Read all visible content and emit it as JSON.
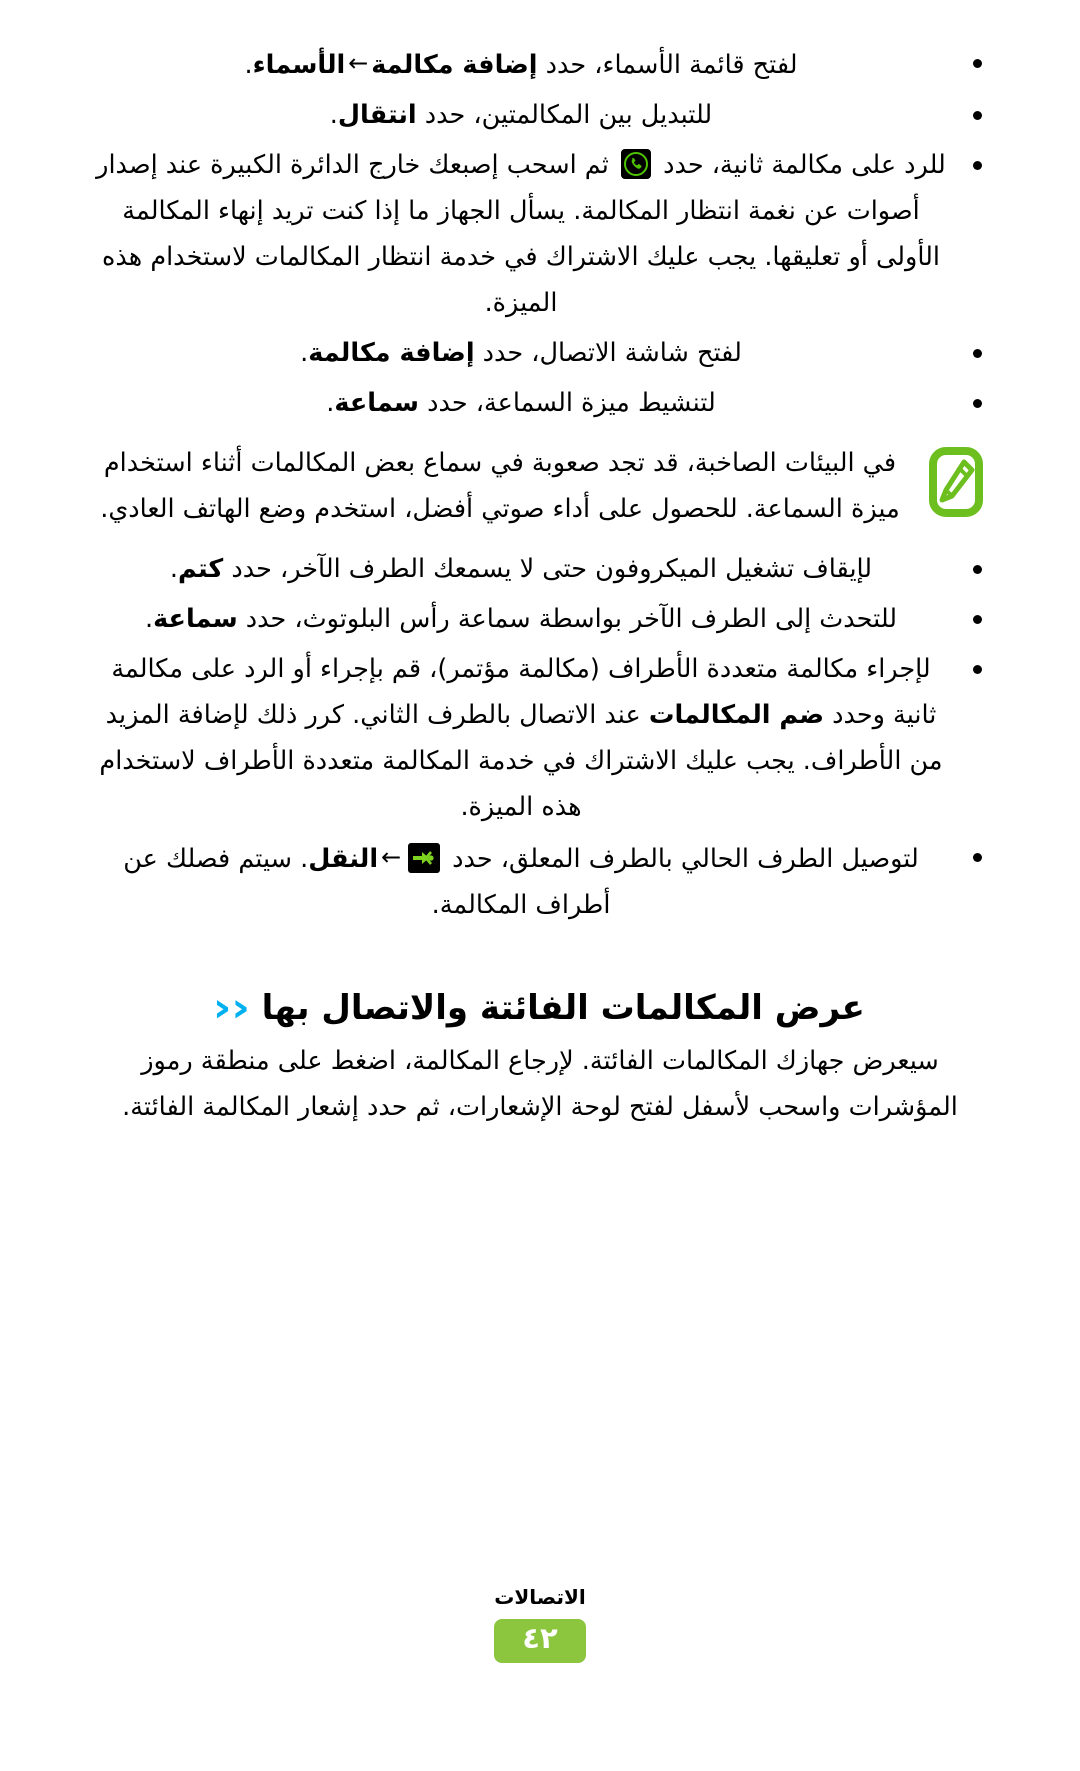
{
  "page": {
    "language": "ar",
    "direction": "rtl"
  },
  "colors": {
    "heading_chevron": "#00b0f0",
    "note_icon_green": "#6cbf1f",
    "icon_green": "#4fc400",
    "page_badge_green": "#8cc63f",
    "text": "#000000",
    "background": "#ffffff"
  },
  "bullets": [
    {
      "id": "open-contacts-list",
      "parts": [
        {
          "type": "text",
          "value": "لفتح قائمة الأسماء، حدد "
        },
        {
          "type": "bold",
          "value": "إضافة مكالمة"
        },
        {
          "type": "arrow",
          "value": "←"
        },
        {
          "type": "bold",
          "value": "الأسماء"
        },
        {
          "type": "text",
          "value": "."
        }
      ],
      "plain": "لفتح قائمة الأسماء، حدد إضافة مكالمة ← الأسماء."
    },
    {
      "id": "switch-between-calls",
      "parts": [
        {
          "type": "text",
          "value": "للتبديل بين المكالمتين، حدد "
        },
        {
          "type": "bold",
          "value": "انتقال"
        },
        {
          "type": "text",
          "value": "."
        }
      ],
      "plain": "للتبديل بين المكالمتين، حدد انتقال."
    },
    {
      "id": "answer-second-call",
      "parts": [
        {
          "type": "text",
          "value": "للرد على مكالمة ثانية، حدد "
        },
        {
          "type": "icon",
          "value": "call-answer-icon"
        },
        {
          "type": "text",
          "value": " ثم اسحب إصبعك خارج الدائرة الكبيرة عند إصدار أصوات عن نغمة انتظار المكالمة. يسأل الجهاز ما إذا كنت تريد إنهاء المكالمة الأولى أو تعليقها. يجب عليك الاشتراك في خدمة انتظار المكالمات لاستخدام هذه الميزة."
        }
      ],
      "plain": "للرد على مكالمة ثانية، حدد ثم اسحب إصبعك خارج الدائرة الكبيرة عند إصدار أصوات عن نغمة انتظار المكالمة. يسأل الجهاز ما إذا كنت تريد إنهاء المكالمة الأولى أو تعليقها. يجب عليك الاشتراك في خدمة انتظار المكالمات لاستخدام هذه الميزة."
    },
    {
      "id": "open-dialing-screen",
      "parts": [
        {
          "type": "text",
          "value": "لفتح شاشة الاتصال، حدد "
        },
        {
          "type": "bold",
          "value": "إضافة مكالمة"
        },
        {
          "type": "text",
          "value": "."
        }
      ],
      "plain": "لفتح شاشة الاتصال، حدد إضافة مكالمة."
    },
    {
      "id": "activate-speaker",
      "parts": [
        {
          "type": "text",
          "value": "لتنشيط ميزة السماعة، حدد "
        },
        {
          "type": "bold",
          "value": "سماعة"
        },
        {
          "type": "text",
          "value": "."
        }
      ],
      "plain": "لتنشيط ميزة السماعة، حدد سماعة."
    }
  ],
  "note": {
    "icon": "note-pencil-icon",
    "text": "في البيئات الصاخبة، قد تجد صعوبة في سماع بعض المكالمات أثناء استخدام ميزة السماعة. للحصول على أداء صوتي أفضل، استخدم وضع الهاتف العادي."
  },
  "bullets2": [
    {
      "id": "mute-microphone",
      "parts": [
        {
          "type": "text",
          "value": "لإيقاف تشغيل الميكروفون حتى لا يسمعك الطرف الآخر، حدد "
        },
        {
          "type": "bold",
          "value": "كتم"
        },
        {
          "type": "text",
          "value": "."
        }
      ],
      "plain": "لإيقاف تشغيل الميكروفون حتى لا يسمعك الطرف الآخر، حدد كتم."
    },
    {
      "id": "bluetooth-headset",
      "parts": [
        {
          "type": "text",
          "value": "للتحدث إلى الطرف الآخر بواسطة سماعة رأس البلوتوث، حدد "
        },
        {
          "type": "bold",
          "value": "سماعة"
        },
        {
          "type": "text",
          "value": "."
        }
      ],
      "plain": "للتحدث إلى الطرف الآخر بواسطة سماعة رأس البلوتوث، حدد سماعة."
    },
    {
      "id": "conference-call",
      "parts": [
        {
          "type": "text",
          "value": "لإجراء مكالمة متعددة الأطراف (مكالمة مؤتمر)، قم بإجراء أو الرد على مكالمة ثانية وحدد "
        },
        {
          "type": "bold",
          "value": "ضم المكالمات"
        },
        {
          "type": "text",
          "value": " عند الاتصال بالطرف الثاني. كرر ذلك لإضافة المزيد من الأطراف. يجب عليك الاشتراك في خدمة المكالمة متعددة الأطراف لاستخدام هذه الميزة."
        }
      ],
      "plain": "لإجراء مكالمة متعددة الأطراف (مكالمة مؤتمر)، قم بإجراء أو الرد على مكالمة ثانية وحدد ضم المكالمات عند الاتصال بالطرف الثاني. كرر ذلك لإضافة المزيد من الأطراف. يجب عليك الاشتراك في خدمة المكالمة متعددة الأطراف لاستخدام هذه الميزة."
    },
    {
      "id": "transfer-call",
      "parts": [
        {
          "type": "text",
          "value": "لتوصيل الطرف الحالي بالطرف المعلق، حدد "
        },
        {
          "type": "icon",
          "value": "call-transfer-icon"
        },
        {
          "type": "arrow",
          "value": "←"
        },
        {
          "type": "bold",
          "value": "النقل"
        },
        {
          "type": "text",
          "value": ". سيتم فصلك عن أطراف المكالمة."
        }
      ],
      "plain": "لتوصيل الطرف الحالي بالطرف المعلق، حدد ← النقل. سيتم فصلك عن أطراف المكالمة."
    }
  ],
  "section": {
    "chevron": "››",
    "title": "عرض المكالمات الفائتة والاتصال بها",
    "paragraph": "سيعرض جهازك المكالمات الفائتة. لإرجاع المكالمة، اضغط على منطقة رموز المؤشرات واسحب لأسفل لفتح لوحة الإشعارات، ثم حدد إشعار المكالمة الفائتة."
  },
  "footer": {
    "label": "الاتصالات",
    "page_number": "٤٢"
  }
}
